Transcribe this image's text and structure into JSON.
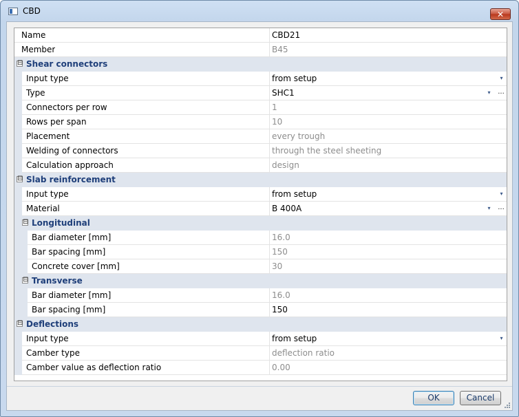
{
  "window": {
    "title": "CBD",
    "close_symbol": "✕"
  },
  "icons": {
    "collapse": "⊟",
    "dropdown": "▾",
    "ellipsis": "..."
  },
  "rows": {
    "name": {
      "label": "Name",
      "value": "CBD21"
    },
    "member": {
      "label": "Member",
      "value": "B45"
    },
    "shear_connectors": {
      "label": "Shear connectors",
      "input_type": {
        "label": "Input type",
        "value": "from setup"
      },
      "type": {
        "label": "Type",
        "value": "SHC1"
      },
      "connectors_per_row": {
        "label": "Connectors per row",
        "value": "1"
      },
      "rows_per_span": {
        "label": "Rows per span",
        "value": "10"
      },
      "placement": {
        "label": "Placement",
        "value": "every trough"
      },
      "welding": {
        "label": "Welding of connectors",
        "value": "through the steel sheeting"
      },
      "calculation": {
        "label": "Calculation approach",
        "value": "design"
      }
    },
    "slab_reinforcement": {
      "label": "Slab reinforcement",
      "input_type": {
        "label": "Input type",
        "value": "from setup"
      },
      "material": {
        "label": "Material",
        "value": "B 400A"
      },
      "longitudinal": {
        "label": "Longitudinal",
        "bar_diameter": {
          "label": "Bar diameter [mm]",
          "value": "16.0"
        },
        "bar_spacing": {
          "label": "Bar spacing [mm]",
          "value": "150"
        },
        "concrete_cover": {
          "label": "Concrete cover [mm]",
          "value": "30"
        }
      },
      "transverse": {
        "label": "Transverse",
        "bar_diameter": {
          "label": "Bar diameter [mm]",
          "value": "16.0"
        },
        "bar_spacing": {
          "label": "Bar spacing [mm]",
          "value": "150"
        }
      }
    },
    "deflections": {
      "label": "Deflections",
      "input_type": {
        "label": "Input type",
        "value": "from setup"
      },
      "camber_type": {
        "label": "Camber type",
        "value": "deflection ratio"
      },
      "camber_value": {
        "label": "Camber value as deflection ratio",
        "value": "0.00"
      }
    }
  },
  "buttons": {
    "ok": "OK",
    "cancel": "Cancel"
  }
}
